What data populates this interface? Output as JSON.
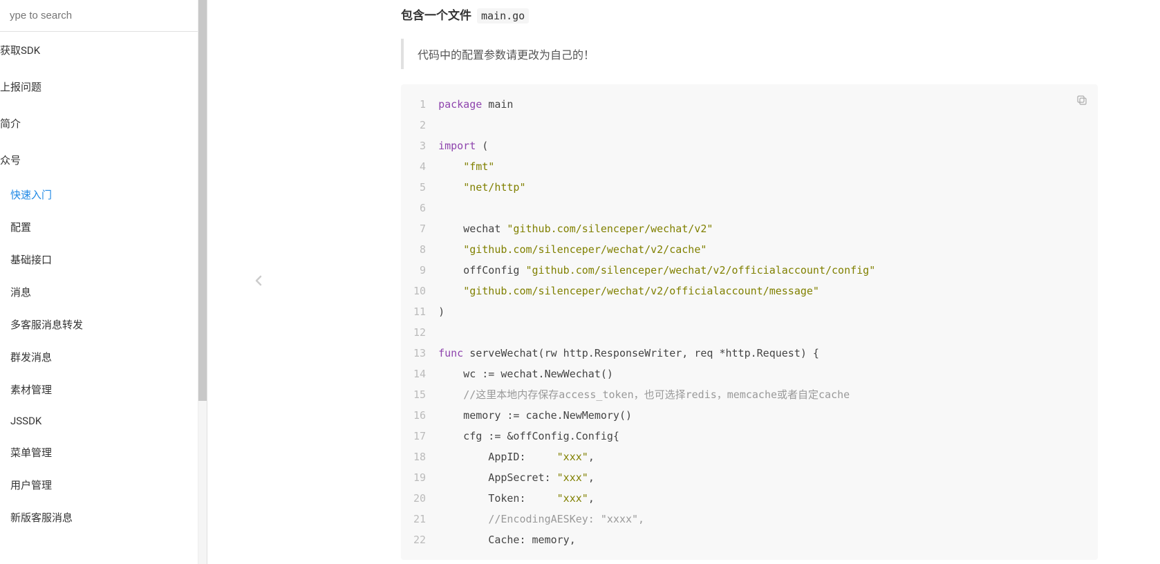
{
  "search": {
    "placeholder": "ype to search"
  },
  "sidebar": {
    "items": [
      {
        "label": "获取SDK",
        "level": 0
      },
      {
        "label": "上报问题",
        "level": 0
      },
      {
        "label": "简介",
        "level": 0
      },
      {
        "label": "众号",
        "level": 0
      },
      {
        "label": "快速入门",
        "level": 1,
        "active": true
      },
      {
        "label": "配置",
        "level": 1
      },
      {
        "label": "基础接口",
        "level": 1
      },
      {
        "label": "消息",
        "level": 1
      },
      {
        "label": "多客服消息转发",
        "level": 1
      },
      {
        "label": "群发消息",
        "level": 1
      },
      {
        "label": "素材管理",
        "level": 1
      },
      {
        "label": "JSSDK",
        "level": 1
      },
      {
        "label": "菜单管理",
        "level": 1
      },
      {
        "label": "用户管理",
        "level": 1
      },
      {
        "label": "新版客服消息",
        "level": 1
      }
    ]
  },
  "main": {
    "heading_prefix": "包含一个文件",
    "heading_filename": "main.go",
    "blockquote": "代码中的配置参数请更改为自己的！",
    "code": {
      "lines": [
        [
          {
            "t": "package",
            "c": "kw"
          },
          {
            "t": " main",
            "c": null
          }
        ],
        [],
        [
          {
            "t": "import",
            "c": "kw"
          },
          {
            "t": " (",
            "c": null
          }
        ],
        [
          {
            "t": "    ",
            "c": null
          },
          {
            "t": "\"fmt\"",
            "c": "str"
          }
        ],
        [
          {
            "t": "    ",
            "c": null
          },
          {
            "t": "\"net/http\"",
            "c": "str"
          }
        ],
        [],
        [
          {
            "t": "    wechat ",
            "c": null
          },
          {
            "t": "\"github.com/silenceper/wechat/v2\"",
            "c": "str"
          }
        ],
        [
          {
            "t": "    ",
            "c": null
          },
          {
            "t": "\"github.com/silenceper/wechat/v2/cache\"",
            "c": "str"
          }
        ],
        [
          {
            "t": "    offConfig ",
            "c": null
          },
          {
            "t": "\"github.com/silenceper/wechat/v2/officialaccount/config\"",
            "c": "str"
          }
        ],
        [
          {
            "t": "    ",
            "c": null
          },
          {
            "t": "\"github.com/silenceper/wechat/v2/officialaccount/message\"",
            "c": "str"
          }
        ],
        [
          {
            "t": ")",
            "c": null
          }
        ],
        [],
        [
          {
            "t": "func",
            "c": "kw"
          },
          {
            "t": " serveWechat(rw http.ResponseWriter, req *http.Request) {",
            "c": null
          }
        ],
        [
          {
            "t": "    wc := wechat.NewWechat()",
            "c": null
          }
        ],
        [
          {
            "t": "    ",
            "c": null
          },
          {
            "t": "//这里本地内存保存access_token，也可选择redis，memcache或者自定cache",
            "c": "cmt"
          }
        ],
        [
          {
            "t": "    memory := cache.NewMemory()",
            "c": null
          }
        ],
        [
          {
            "t": "    cfg := &offConfig.Config{",
            "c": null
          }
        ],
        [
          {
            "t": "        AppID:     ",
            "c": null
          },
          {
            "t": "\"xxx\"",
            "c": "str"
          },
          {
            "t": ",",
            "c": null
          }
        ],
        [
          {
            "t": "        AppSecret: ",
            "c": null
          },
          {
            "t": "\"xxx\"",
            "c": "str"
          },
          {
            "t": ",",
            "c": null
          }
        ],
        [
          {
            "t": "        Token:     ",
            "c": null
          },
          {
            "t": "\"xxx\"",
            "c": "str"
          },
          {
            "t": ",",
            "c": null
          }
        ],
        [
          {
            "t": "        ",
            "c": null
          },
          {
            "t": "//EncodingAESKey: \"xxxx\",",
            "c": "cmt"
          }
        ],
        [
          {
            "t": "        Cache: memory,",
            "c": null
          }
        ]
      ]
    }
  }
}
